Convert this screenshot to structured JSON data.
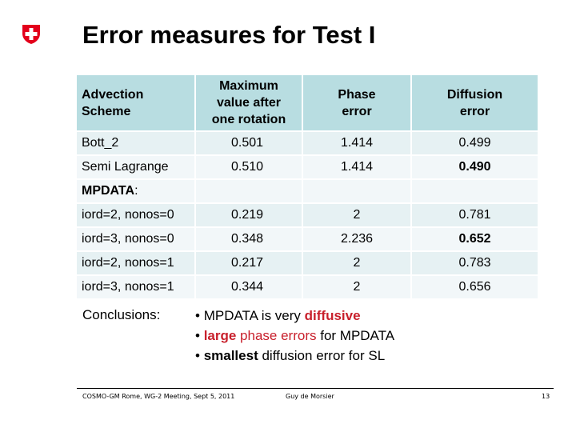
{
  "header": {
    "logo": "swiss-coat-of-arms-icon",
    "title": "Error measures for Test I"
  },
  "table": {
    "columns": [
      "Advection Scheme",
      "Maximum value after one rotation",
      "Phase error",
      "Diffusion error"
    ],
    "column_lines": [
      [
        "Advection",
        "Scheme"
      ],
      [
        "Maximum",
        "value after",
        "one rotation"
      ],
      [
        "Phase",
        "error"
      ],
      [
        "Diffusion",
        "error"
      ]
    ],
    "rows": [
      {
        "scheme": "Bott_2",
        "max_value": "0.501",
        "phase_error": "1.414",
        "diffusion_error": "0.499",
        "diffusion_bold": false
      },
      {
        "scheme": "Semi Lagrange",
        "max_value": "0.510",
        "phase_error": "1.414",
        "diffusion_error": "0.490",
        "diffusion_bold": true
      },
      {
        "scheme_bold": "MPDATA",
        "scheme_suffix": ":",
        "max_value": "",
        "phase_error": "",
        "diffusion_error": "",
        "section": true
      },
      {
        "scheme": "iord=2, nonos=0",
        "max_value": "0.219",
        "phase_error": "2",
        "diffusion_error": "0.781",
        "diffusion_bold": false
      },
      {
        "scheme": "iord=3, nonos=0",
        "max_value": "0.348",
        "phase_error": "2.236",
        "diffusion_error": "0.652",
        "diffusion_bold": true
      },
      {
        "scheme": "iord=2, nonos=1",
        "max_value": "0.217",
        "phase_error": "2",
        "diffusion_error": "0.783",
        "diffusion_bold": false
      },
      {
        "scheme": "iord=3, nonos=1",
        "max_value": "0.344",
        "phase_error": "2",
        "diffusion_error": "0.656",
        "diffusion_bold": false
      }
    ],
    "colors": {
      "header_bg": "#b8dde1",
      "row_odd": "#e6f1f3",
      "row_even": "#f2f7f9"
    }
  },
  "conclusions": {
    "label": "Conclusions:",
    "bullet": "•",
    "items": [
      {
        "parts": [
          {
            "text": "MPDATA is very ",
            "style": "normal"
          },
          {
            "text": "diffusive",
            "style": "red-bold"
          }
        ]
      },
      {
        "parts": [
          {
            "text": "large",
            "style": "red-bold"
          },
          {
            "text": " phase errors",
            "style": "red"
          },
          {
            "text": " for MPDATA",
            "style": "normal"
          }
        ]
      },
      {
        "parts": [
          {
            "text": "smallest",
            "style": "bold"
          },
          {
            "text": " diffusion error for SL",
            "style": "normal"
          }
        ]
      }
    ],
    "accent_color": "#c8202c"
  },
  "footer": {
    "event": "COSMO-GM Rome, WG-2 Meeting, Sept 5, 2011",
    "author": "Guy de Morsier",
    "page_number": "13"
  }
}
